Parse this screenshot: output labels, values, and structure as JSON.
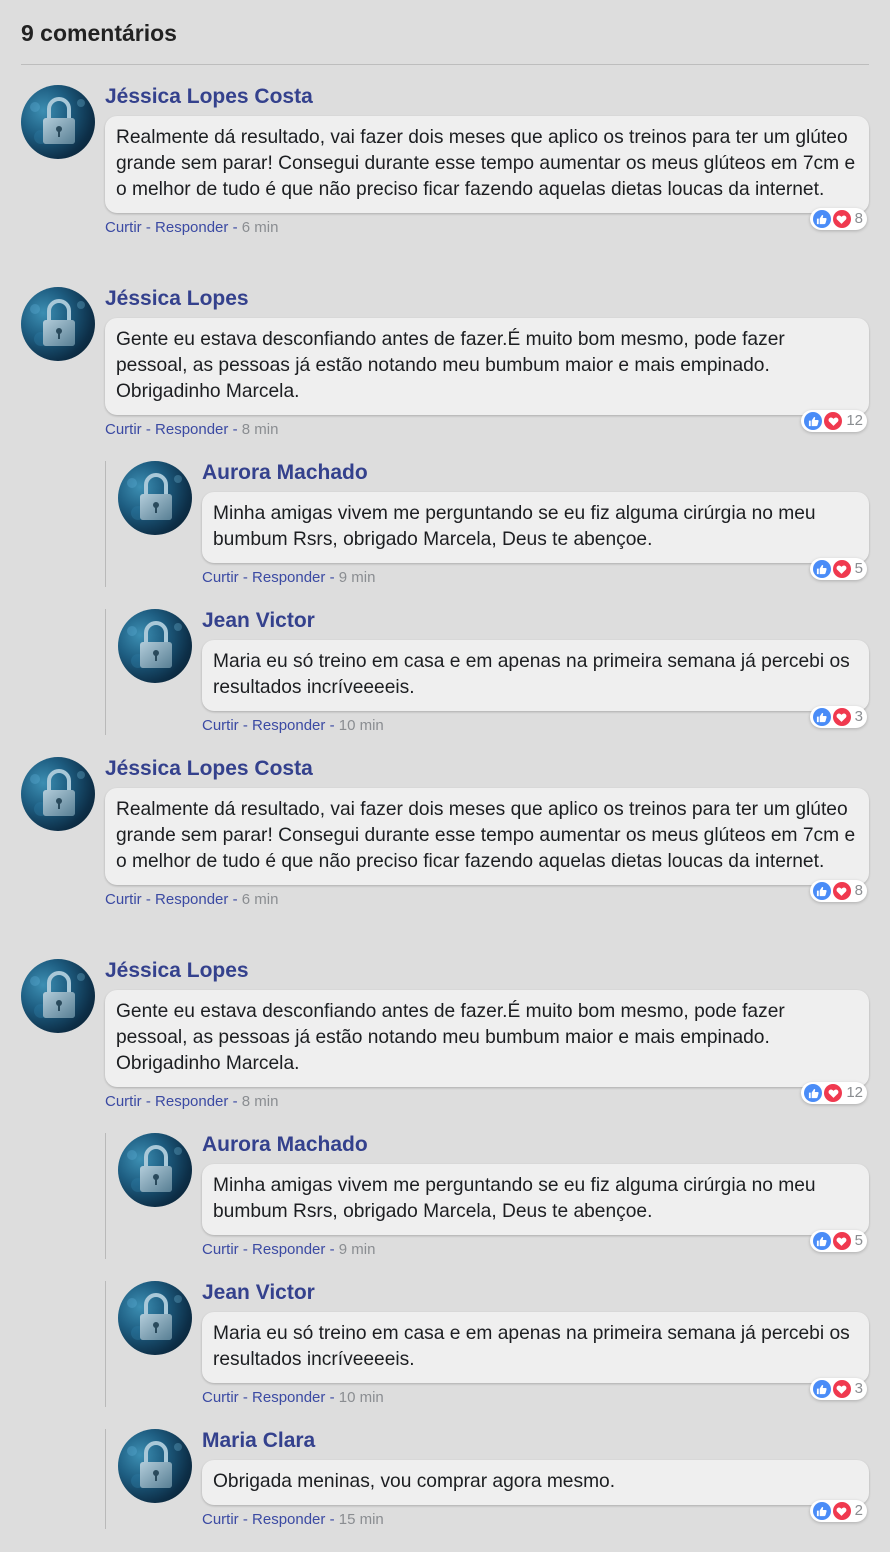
{
  "header": {
    "title": "9 comentários"
  },
  "comments": [
    {
      "name": "Jéssica Lopes Costa",
      "text": "Realmente dá resultado, vai fazer dois meses que aplico os treinos para ter um glúteo grande sem parar! Consegui durante esse tempo aumentar os meus glúteos em 7cm e o melhor de tudo é que não preciso ficar fazendo aquelas dietas loucas da internet.",
      "like": "Curtir",
      "reply": "Responder",
      "time": "6 min",
      "reactions": "8"
    },
    {
      "name": "Jéssica Lopes",
      "text": "Gente eu estava desconfiando antes de fazer.É muito bom mesmo, pode fazer pessoal, as pessoas já estão notando meu bumbum maior e mais empinado. Obrigadinho Marcela.",
      "like": "Curtir",
      "reply": "Responder",
      "time": "8 min",
      "reactions": "12"
    },
    {
      "name": "Aurora Machado",
      "text": "Minha amigas vivem me perguntando se eu fiz alguma cirúrgia no meu bumbum Rsrs, obrigado Marcela, Deus te abençoe.",
      "like": "Curtir",
      "reply": "Responder",
      "time": "9 min",
      "reactions": "5"
    },
    {
      "name": "Jean Victor",
      "text": "Maria eu só treino em casa e em apenas na primeira semana já percebi os resultados incríveeeeis.",
      "like": "Curtir",
      "reply": "Responder",
      "time": "10 min",
      "reactions": "3"
    },
    {
      "name": "Jéssica Lopes Costa",
      "text": "Realmente dá resultado, vai fazer dois meses que aplico os treinos para ter um glúteo grande sem parar! Consegui durante esse tempo aumentar os meus glúteos em 7cm e o melhor de tudo é que não preciso ficar fazendo aquelas dietas loucas da internet.",
      "like": "Curtir",
      "reply": "Responder",
      "time": "6 min",
      "reactions": "8"
    },
    {
      "name": "Jéssica Lopes",
      "text": "Gente eu estava desconfiando antes de fazer.É muito bom mesmo, pode fazer pessoal, as pessoas já estão notando meu bumbum maior e mais empinado. Obrigadinho Marcela.",
      "like": "Curtir",
      "reply": "Responder",
      "time": "8 min",
      "reactions": "12"
    },
    {
      "name": "Aurora Machado",
      "text": "Minha amigas vivem me perguntando se eu fiz alguma cirúrgia no meu bumbum Rsrs, obrigado Marcela, Deus te abençoe.",
      "like": "Curtir",
      "reply": "Responder",
      "time": "9 min",
      "reactions": "5"
    },
    {
      "name": "Jean Victor",
      "text": "Maria eu só treino em casa e em apenas na primeira semana já percebi os resultados incríveeeeis.",
      "like": "Curtir",
      "reply": "Responder",
      "time": "10 min",
      "reactions": "3"
    },
    {
      "name": "Maria Clara",
      "text": "Obrigada meninas, vou comprar agora mesmo.",
      "like": "Curtir",
      "reply": "Responder",
      "time": "15 min",
      "reactions": "2"
    }
  ],
  "colors": {
    "name": "#34418d",
    "link": "#3b4aa3",
    "bubble": "#efefef",
    "background": "#dddddd",
    "like": "#4a8cf7",
    "love": "#f0394f"
  },
  "icons": {
    "avatar": "padlock-photo-avatar",
    "like": "thumbs-up-icon",
    "love": "heart-icon"
  }
}
